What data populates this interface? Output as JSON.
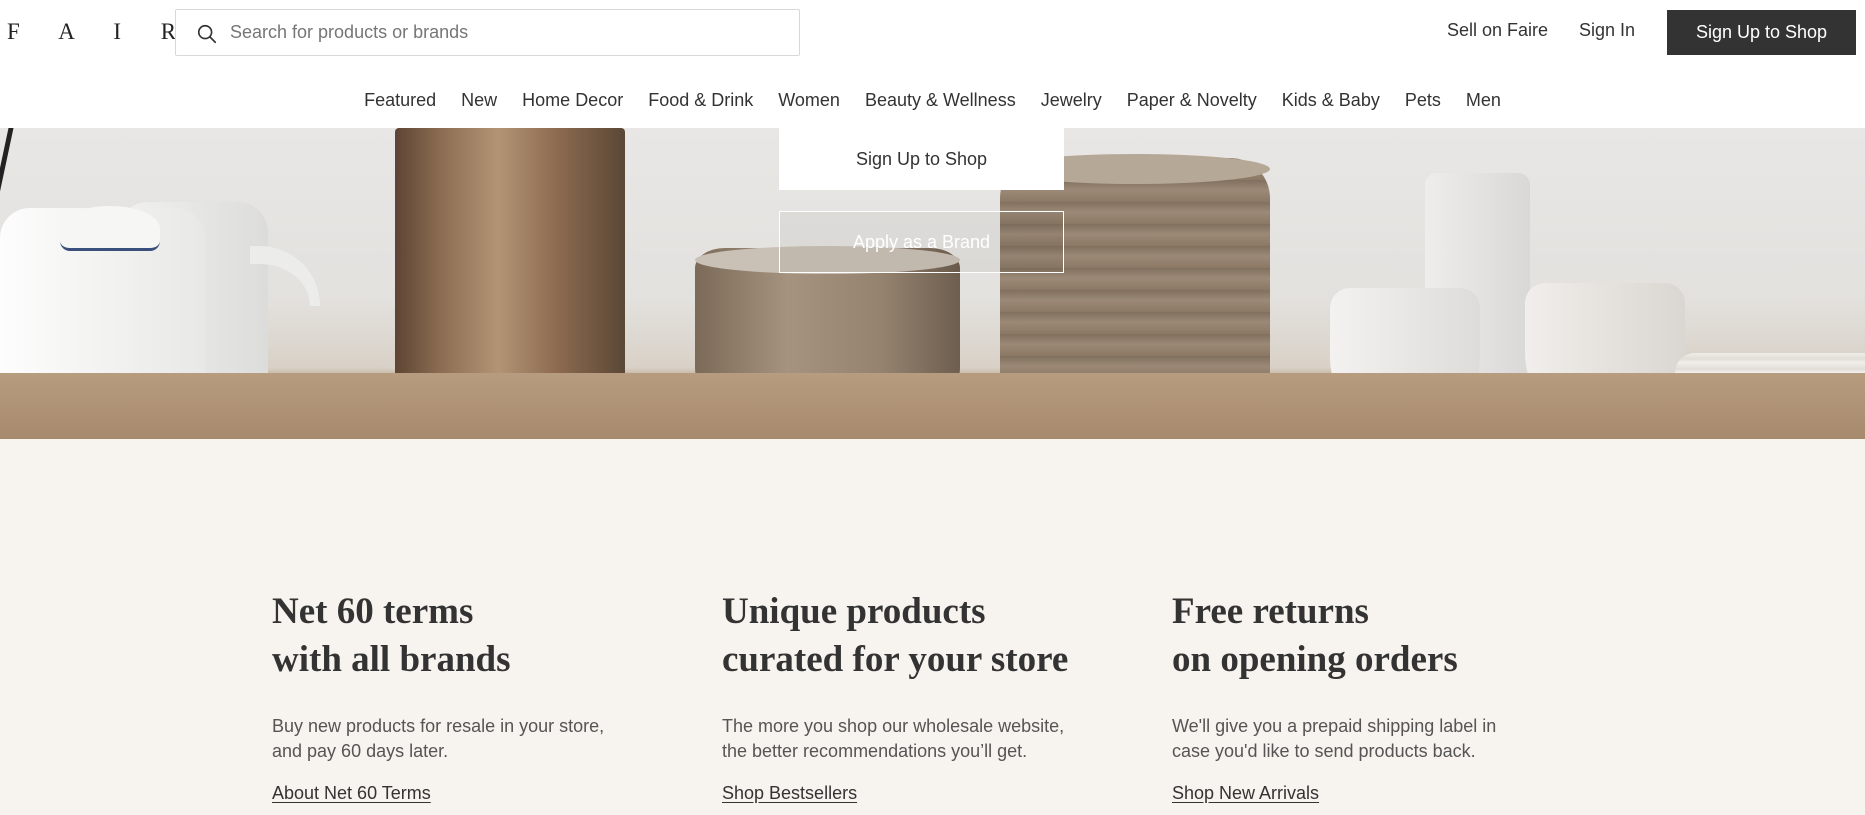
{
  "header": {
    "logo": "F A I R E",
    "search_placeholder": "Search for products or brands",
    "sell_on_faire": "Sell on Faire",
    "sign_in": "Sign In",
    "sign_up": "Sign Up to Shop"
  },
  "nav": [
    "Featured",
    "New",
    "Home Decor",
    "Food & Drink",
    "Women",
    "Beauty & Wellness",
    "Jewelry",
    "Paper & Novelty",
    "Kids & Baby",
    "Pets",
    "Men"
  ],
  "hero": {
    "sign_up_button": "Sign Up to Shop",
    "apply_button": "Apply as a Brand"
  },
  "features": [
    {
      "title": "Net 60 terms\nwith all brands",
      "description": "Buy new products for resale in your store,\nand pay 60 days later.",
      "link": "About Net 60 Terms"
    },
    {
      "title": "Unique products\ncurated for your store",
      "description": "The more you shop our wholesale website,\nthe better recommendations you’ll get.",
      "link": "Shop Bestsellers"
    },
    {
      "title": "Free returns\non opening orders",
      "description": "We'll give you a prepaid shipping label in\ncase you'd like to send products back.",
      "link": "Shop New Arrivals"
    }
  ],
  "colors": {
    "page_background": "#f7f3ee",
    "dark_button": "#333333",
    "text": "#333333"
  }
}
